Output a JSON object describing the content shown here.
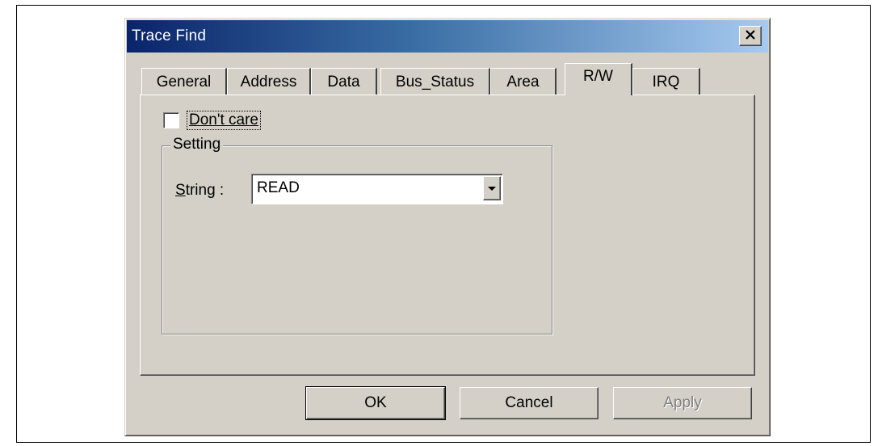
{
  "window": {
    "title": "Trace Find"
  },
  "tabs": [
    {
      "label": "General",
      "active": false
    },
    {
      "label": "Address",
      "active": false
    },
    {
      "label": "Data",
      "active": false
    },
    {
      "label": "Bus_Status",
      "active": false
    },
    {
      "label": "Area",
      "active": false
    },
    {
      "label": "R/W",
      "active": true
    },
    {
      "label": "IRQ",
      "active": false
    }
  ],
  "panel": {
    "dont_care": {
      "label": "Don't care",
      "checked": false
    },
    "setting": {
      "legend": "Setting",
      "string_label_prefix": "S",
      "string_label_rest": "tring :",
      "string_value": "READ"
    }
  },
  "buttons": {
    "ok": "OK",
    "cancel": "Cancel",
    "apply": "Apply"
  },
  "icons": {
    "close": "close-icon",
    "dropdown": "chevron-down-icon"
  }
}
